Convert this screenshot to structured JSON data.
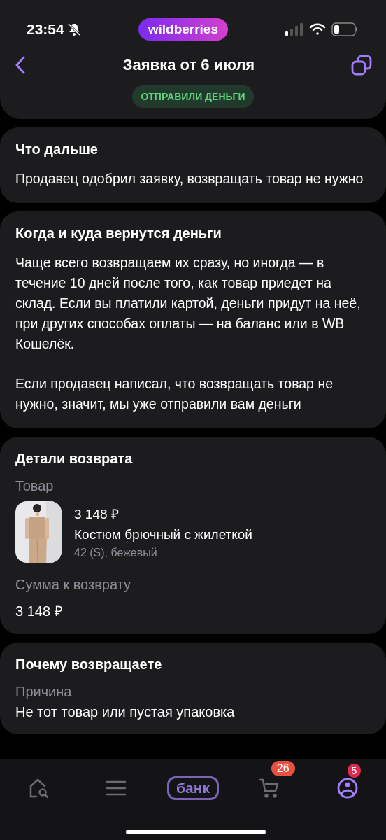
{
  "status_bar": {
    "time": "23:54",
    "brand": "wildberries"
  },
  "header": {
    "title": "Заявка от 6 июля",
    "status_badge": "ОТПРАВИЛИ ДЕНЬГИ"
  },
  "next_steps": {
    "title": "Что дальше",
    "text": "Продавец одобрил заявку, возвращать товар не нужно"
  },
  "refund_info": {
    "title": "Когда и куда вернутся деньги",
    "paragraphs": [
      "Чаще всего возвращаем их сразу, но иногда — в течение 10 дней после того, как товар приедет на склад. Если вы платили картой, деньги придут на неё, при других способах оплаты — на баланс или в WB Кошелёк.",
      "Если продавец написал, что возвращать товар не нужно, значит, мы уже отправили вам деньги"
    ]
  },
  "return_details": {
    "title": "Детали возврата",
    "product_label": "Товар",
    "product": {
      "price": "3 148 ₽",
      "name": "Костюм брючный с жилеткой",
      "variant": "42 (S), бежевый"
    },
    "amount_label": "Сумма к возврату",
    "amount": "3 148 ₽"
  },
  "return_reason": {
    "title": "Почему возвращаете",
    "reason_label": "Причина",
    "reason": "Не тот товар или пустая упаковка"
  },
  "tab_bar": [
    {
      "kind": "home",
      "selected": false
    },
    {
      "kind": "catalog",
      "selected": false
    },
    {
      "kind": "bank",
      "label": "банк",
      "selected": false
    },
    {
      "kind": "cart",
      "badge": "26",
      "selected": false
    },
    {
      "kind": "profile",
      "badge": "5",
      "selected": true
    }
  ]
}
